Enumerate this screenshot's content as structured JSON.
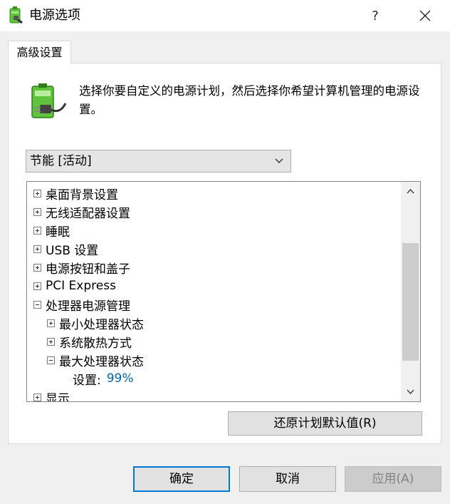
{
  "window": {
    "title": "电源选项",
    "help_label": "?"
  },
  "tab": {
    "label": "高级设置"
  },
  "description": "选择你要自定义的电源计划，然后选择你希望计算机管理的电源设置。",
  "plan_dropdown": {
    "selected": "节能 [活动]"
  },
  "tree": {
    "items": [
      {
        "label": "桌面背景设置",
        "expander": "plus",
        "level": 0
      },
      {
        "label": "无线适配器设置",
        "expander": "plus",
        "level": 0
      },
      {
        "label": "睡眠",
        "expander": "plus",
        "level": 0
      },
      {
        "label": "USB 设置",
        "expander": "plus",
        "level": 0
      },
      {
        "label": "电源按钮和盖子",
        "expander": "plus",
        "level": 0
      },
      {
        "label": "PCI Express",
        "expander": "plus",
        "level": 0
      },
      {
        "label": "处理器电源管理",
        "expander": "minus",
        "level": 0
      },
      {
        "label": "最小处理器状态",
        "expander": "plus",
        "level": 1
      },
      {
        "label": "系统散热方式",
        "expander": "plus",
        "level": 1
      },
      {
        "label": "最大处理器状态",
        "expander": "minus",
        "level": 1
      },
      {
        "label": "设置:",
        "value": "99%",
        "level": 2
      },
      {
        "label": "显示",
        "expander": "plus",
        "level": 0
      }
    ]
  },
  "buttons": {
    "restore": "还原计划默认值(R)",
    "ok": "确定",
    "cancel": "取消",
    "apply": "应用(A)"
  },
  "colors": {
    "value_text": "#0066b4",
    "ok_border": "#0078d7",
    "battery_green": "#5fc43c"
  },
  "icons": [
    "power-options-icon",
    "help-icon",
    "close-icon",
    "battery-plug-icon",
    "chevron-down-icon",
    "scroll-up-icon",
    "scroll-down-icon",
    "expand-icon",
    "collapse-icon"
  ]
}
